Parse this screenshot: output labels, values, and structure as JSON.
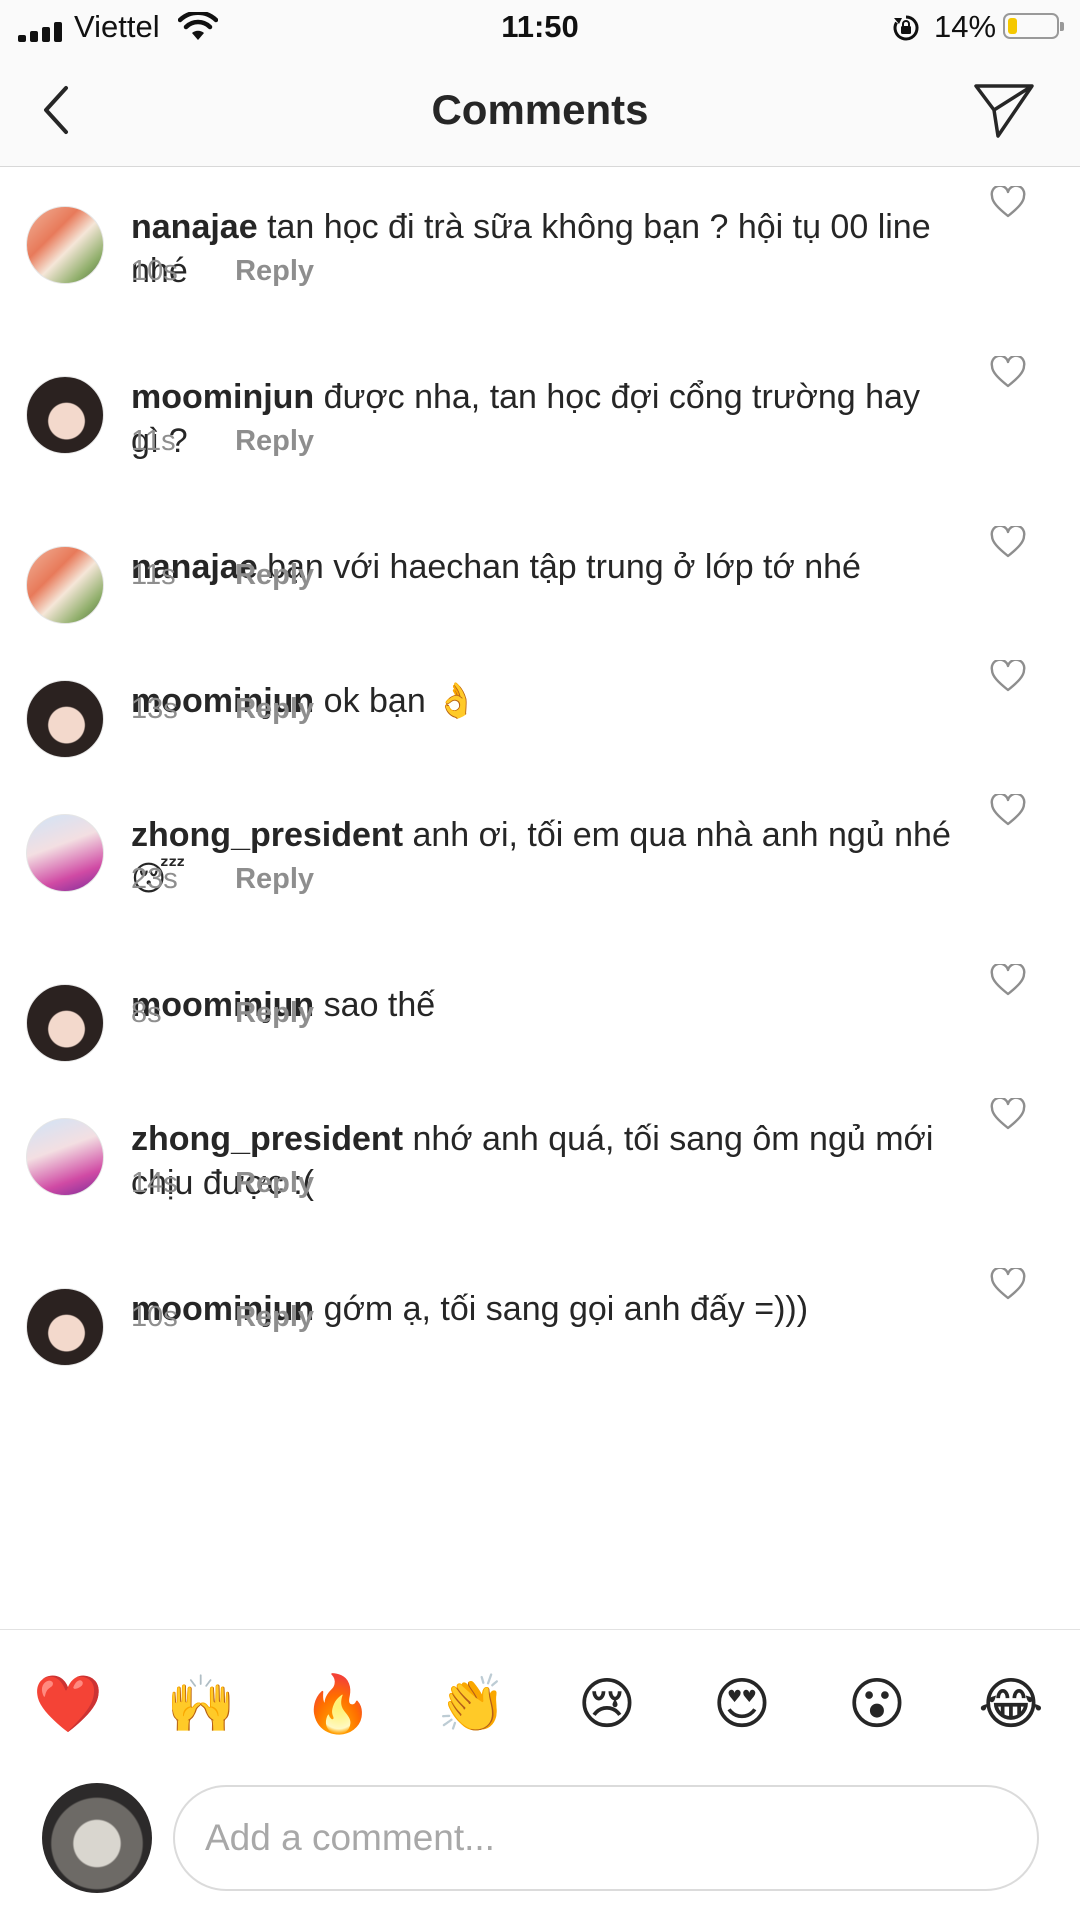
{
  "status_bar": {
    "carrier": "Viettel",
    "time": "11:50",
    "battery": "14%"
  },
  "header": {
    "title": "Comments"
  },
  "comments": [
    {
      "user": "nanajae",
      "text": "tan học đi trà sữa không bạn ? hội tụ 00 line nhé",
      "time": "10s",
      "reply": "Reply",
      "avatar": "avatar-nanajae"
    },
    {
      "user": "moominjun",
      "text": "được nha, tan học đợi cổng trường hay gì ?",
      "time": "11s",
      "reply": "Reply",
      "avatar": "avatar-moominjun"
    },
    {
      "user": "nanajae",
      "text": "bạn với haechan tập trung ở lớp tớ nhé",
      "time": "11s",
      "reply": "Reply",
      "avatar": "avatar-nanajae"
    },
    {
      "user": "moominjun",
      "text": "ok bạn 👌",
      "time": "13s",
      "reply": "Reply",
      "avatar": "avatar-moominjun"
    },
    {
      "user": "zhong_president",
      "text": "anh ơi, tối em qua nhà anh ngủ nhé 😴",
      "time": "23s",
      "reply": "Reply",
      "avatar": "avatar-zhong"
    },
    {
      "user": "moominjun",
      "text": "sao thế",
      "time": "8s",
      "reply": "Reply",
      "avatar": "avatar-moominjun"
    },
    {
      "user": "zhong_president",
      "text": "nhớ anh quá, tối sang ôm ngủ mới chịu được :(",
      "time": "14s",
      "reply": "Reply",
      "avatar": "avatar-zhong"
    },
    {
      "user": "moominjun",
      "text": "gớm ạ, tối sang gọi anh đấy =)))",
      "time": "10s",
      "reply": "Reply",
      "avatar": "avatar-moominjun"
    }
  ],
  "quick_reactions": [
    "❤️",
    "🙌",
    "🔥",
    "👏",
    "😢",
    "😍",
    "😮",
    "😂"
  ],
  "composer": {
    "placeholder": "Add a comment..."
  },
  "colors": {
    "text": "#262626",
    "secondary": "#8e8e8e",
    "border": "#dbdbdb"
  }
}
